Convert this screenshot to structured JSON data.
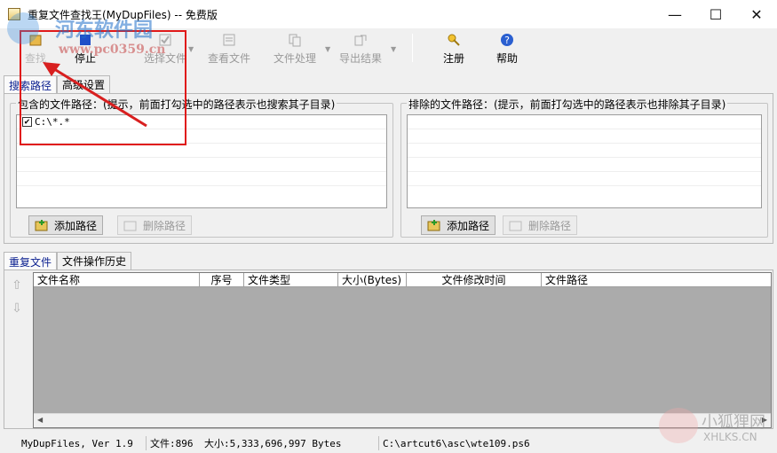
{
  "window": {
    "title": "重复文件查找王(MyDupFiles) -- 免费版",
    "minimize": "—",
    "maximize": "☐",
    "close": "✕"
  },
  "toolbar": {
    "search": "查找",
    "stop": "停止",
    "select_files": "选择文件",
    "view_files": "查看文件",
    "file_process": "文件处理",
    "export": "导出结果",
    "register": "注册",
    "help": "帮助"
  },
  "top_tabs": [
    "搜索路径",
    "高级设置"
  ],
  "include_box": {
    "legend": "包含的文件路径：(提示，前面打勾选中的路径表示也搜索其子目录)",
    "items": [
      {
        "checked": true,
        "path": "C:\\*.*"
      }
    ],
    "add": "添加路径",
    "delete": "删除路径"
  },
  "exclude_box": {
    "legend": "排除的文件路径：(提示，前面打勾选中的路径表示也排除其子目录)",
    "add": "添加路径",
    "delete": "删除路径"
  },
  "bottom_tabs": [
    "重复文件",
    "文件操作历史"
  ],
  "grid": {
    "columns": [
      "文件名称",
      "序号",
      "文件类型",
      "大小(Bytes)",
      "文件修改时间",
      "文件路径"
    ]
  },
  "status": {
    "version": "MyDupFiles, Ver 1.9",
    "files": "文件:896",
    "size": "大小:5,333,696,997 Bytes",
    "current_path": "C:\\artcut6\\asc\\wte109.ps6"
  },
  "watermarks": {
    "site_name": "河东软件园",
    "site_url": "www.pc0359.cn",
    "corner_name": "小狐狸网",
    "corner_url": "XHLKS.CN"
  },
  "colors": {
    "annotation": "#e01919",
    "active_tab_text": "#0a1f8f"
  }
}
